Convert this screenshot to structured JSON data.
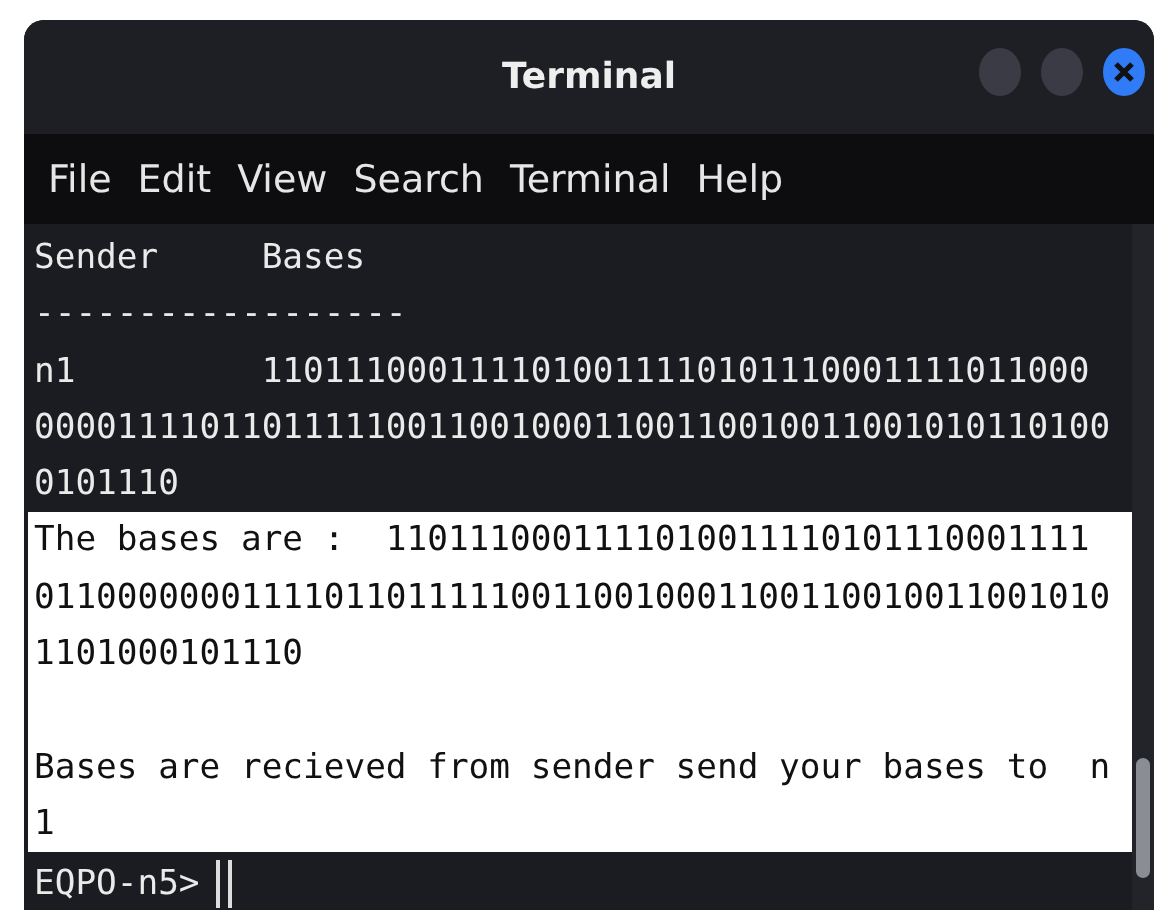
{
  "window": {
    "title": "Terminal"
  },
  "menu": [
    {
      "label": "File"
    },
    {
      "label": "Edit"
    },
    {
      "label": "View"
    },
    {
      "label": "Search"
    },
    {
      "label": "Terminal"
    },
    {
      "label": "Help"
    }
  ],
  "terminal": {
    "lines": [
      {
        "kind": "text",
        "text": "Sender     Bases",
        "highlighted": false
      },
      {
        "kind": "text",
        "text": "------------------",
        "highlighted": false
      },
      {
        "kind": "text",
        "text": "n1         1101110001111010011110101110001111011000",
        "highlighted": false
      },
      {
        "kind": "text",
        "text": "0000111101101111100110010001100110010011001010110100",
        "highlighted": false
      },
      {
        "kind": "text",
        "text": "0101110",
        "highlighted": false
      },
      {
        "kind": "text",
        "text": "The bases are :  1101110001111010011110101110001111",
        "highlighted": true
      },
      {
        "kind": "text",
        "text": "0110000000111101101111100110010001100110010011001010",
        "highlighted": true
      },
      {
        "kind": "text",
        "text": "1101000101110",
        "highlighted": true
      },
      {
        "kind": "blank",
        "highlighted": true
      },
      {
        "kind": "text",
        "text": "Bases are recieved from sender send your bases to  n",
        "highlighted": true
      },
      {
        "kind": "text",
        "text": "1",
        "highlighted": true
      }
    ],
    "prompt": "EQPO-n5>"
  }
}
